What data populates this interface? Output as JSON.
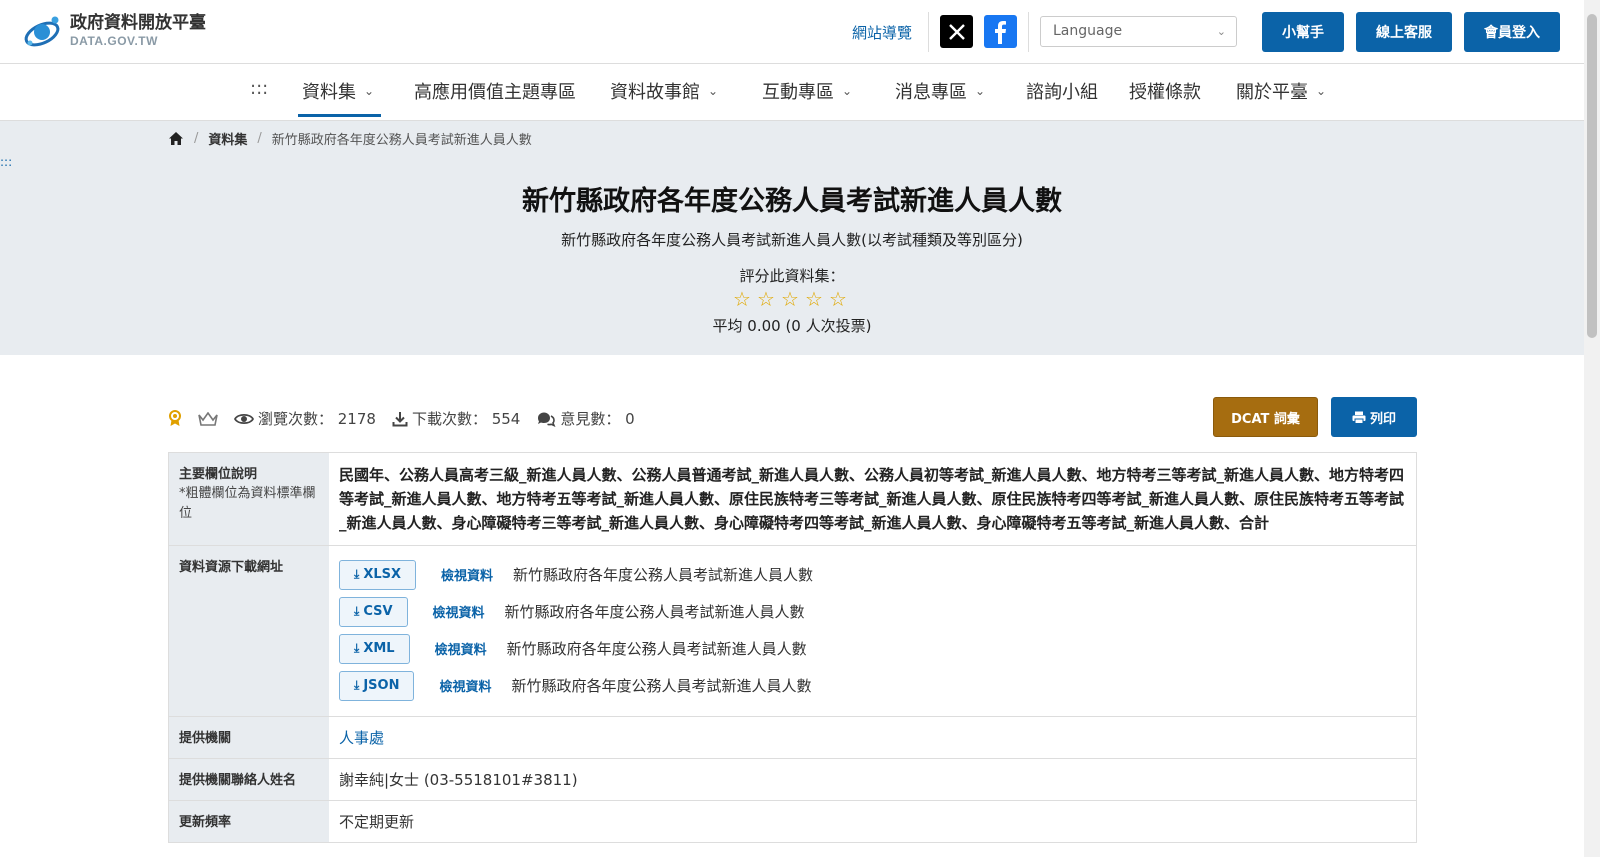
{
  "header": {
    "logo_title": "政府資料開放平臺",
    "logo_sub": "DATA.GOV.TW",
    "sitemap": "網站導覽",
    "language_placeholder": "Language",
    "buttons": [
      "小幫手",
      "線上客服",
      "會員登入"
    ]
  },
  "nav": {
    "menu_icon": ":::",
    "items": [
      "資料集",
      "高應用價值主題專區",
      "資料故事館",
      "互動專區",
      "消息專區",
      "諮詢小組",
      "授權條款",
      "關於平臺"
    ],
    "active": "資料集"
  },
  "breadcrumb": {
    "items": [
      "資料集",
      "新竹縣政府各年度公務人員考試新進人員人數"
    ]
  },
  "side_mark": ":::",
  "hero": {
    "title": "新竹縣政府各年度公務人員考試新進人員人數",
    "description": "新竹縣政府各年度公務人員考試新進人員人數(以考試種類及等別區分)",
    "rate_label": "評分此資料集：",
    "rating_value": 0,
    "rating_max": 5,
    "average": "平均 0.00 (0 人次投票)"
  },
  "stats": {
    "views": "瀏覽次數： 2178",
    "downloads": "下載次數： 554",
    "comments": "意見數： 0"
  },
  "actions": {
    "dcat": "DCAT 詞彙",
    "print": "列印"
  },
  "info": {
    "fields_label": "主要欄位說明",
    "fields_note": "*粗體欄位為資料標準欄位",
    "fields_value": "民國年、公務人員高考三級_新進人員人數、公務人員普通考試_新進人員人數、公務人員初等考試_新進人員人數、地方特考三等考試_新進人員人數、地方特考四等考試_新進人員人數、地方特考五等考試_新進人員人數、原住民族特考三等考試_新進人員人數、原住民族特考四等考試_新進人員人數、原住民族特考五等考試_新進人員人數、身心障礙特考三等考試_新進人員人數、身心障礙特考四等考試_新進人員人數、身心障礙特考五等考試_新進人員人數、合計",
    "resources_label": "資料資源下載網址",
    "resources": [
      {
        "format": "XLSX",
        "view": "檢視資料",
        "name": "新竹縣政府各年度公務人員考試新進人員人數"
      },
      {
        "format": "CSV",
        "view": "檢視資料",
        "name": "新竹縣政府各年度公務人員考試新進人員人數"
      },
      {
        "format": "XML",
        "view": "檢視資料",
        "name": "新竹縣政府各年度公務人員考試新進人員人數"
      },
      {
        "format": "JSON",
        "view": "檢視資料",
        "name": "新竹縣政府各年度公務人員考試新進人員人數"
      }
    ],
    "agency_label": "提供機關",
    "agency_value": "人事處",
    "contact_label": "提供機關聯絡人姓名",
    "contact_value": "謝幸純|女士 (03-5518101#3811)",
    "frequency_label": "更新頻率",
    "frequency_value": "不定期更新"
  },
  "colors": {
    "primary": "#0b63a8",
    "dcat": "#a66d10",
    "hero_bg": "#e8ecf0",
    "star": "#e0a800"
  }
}
